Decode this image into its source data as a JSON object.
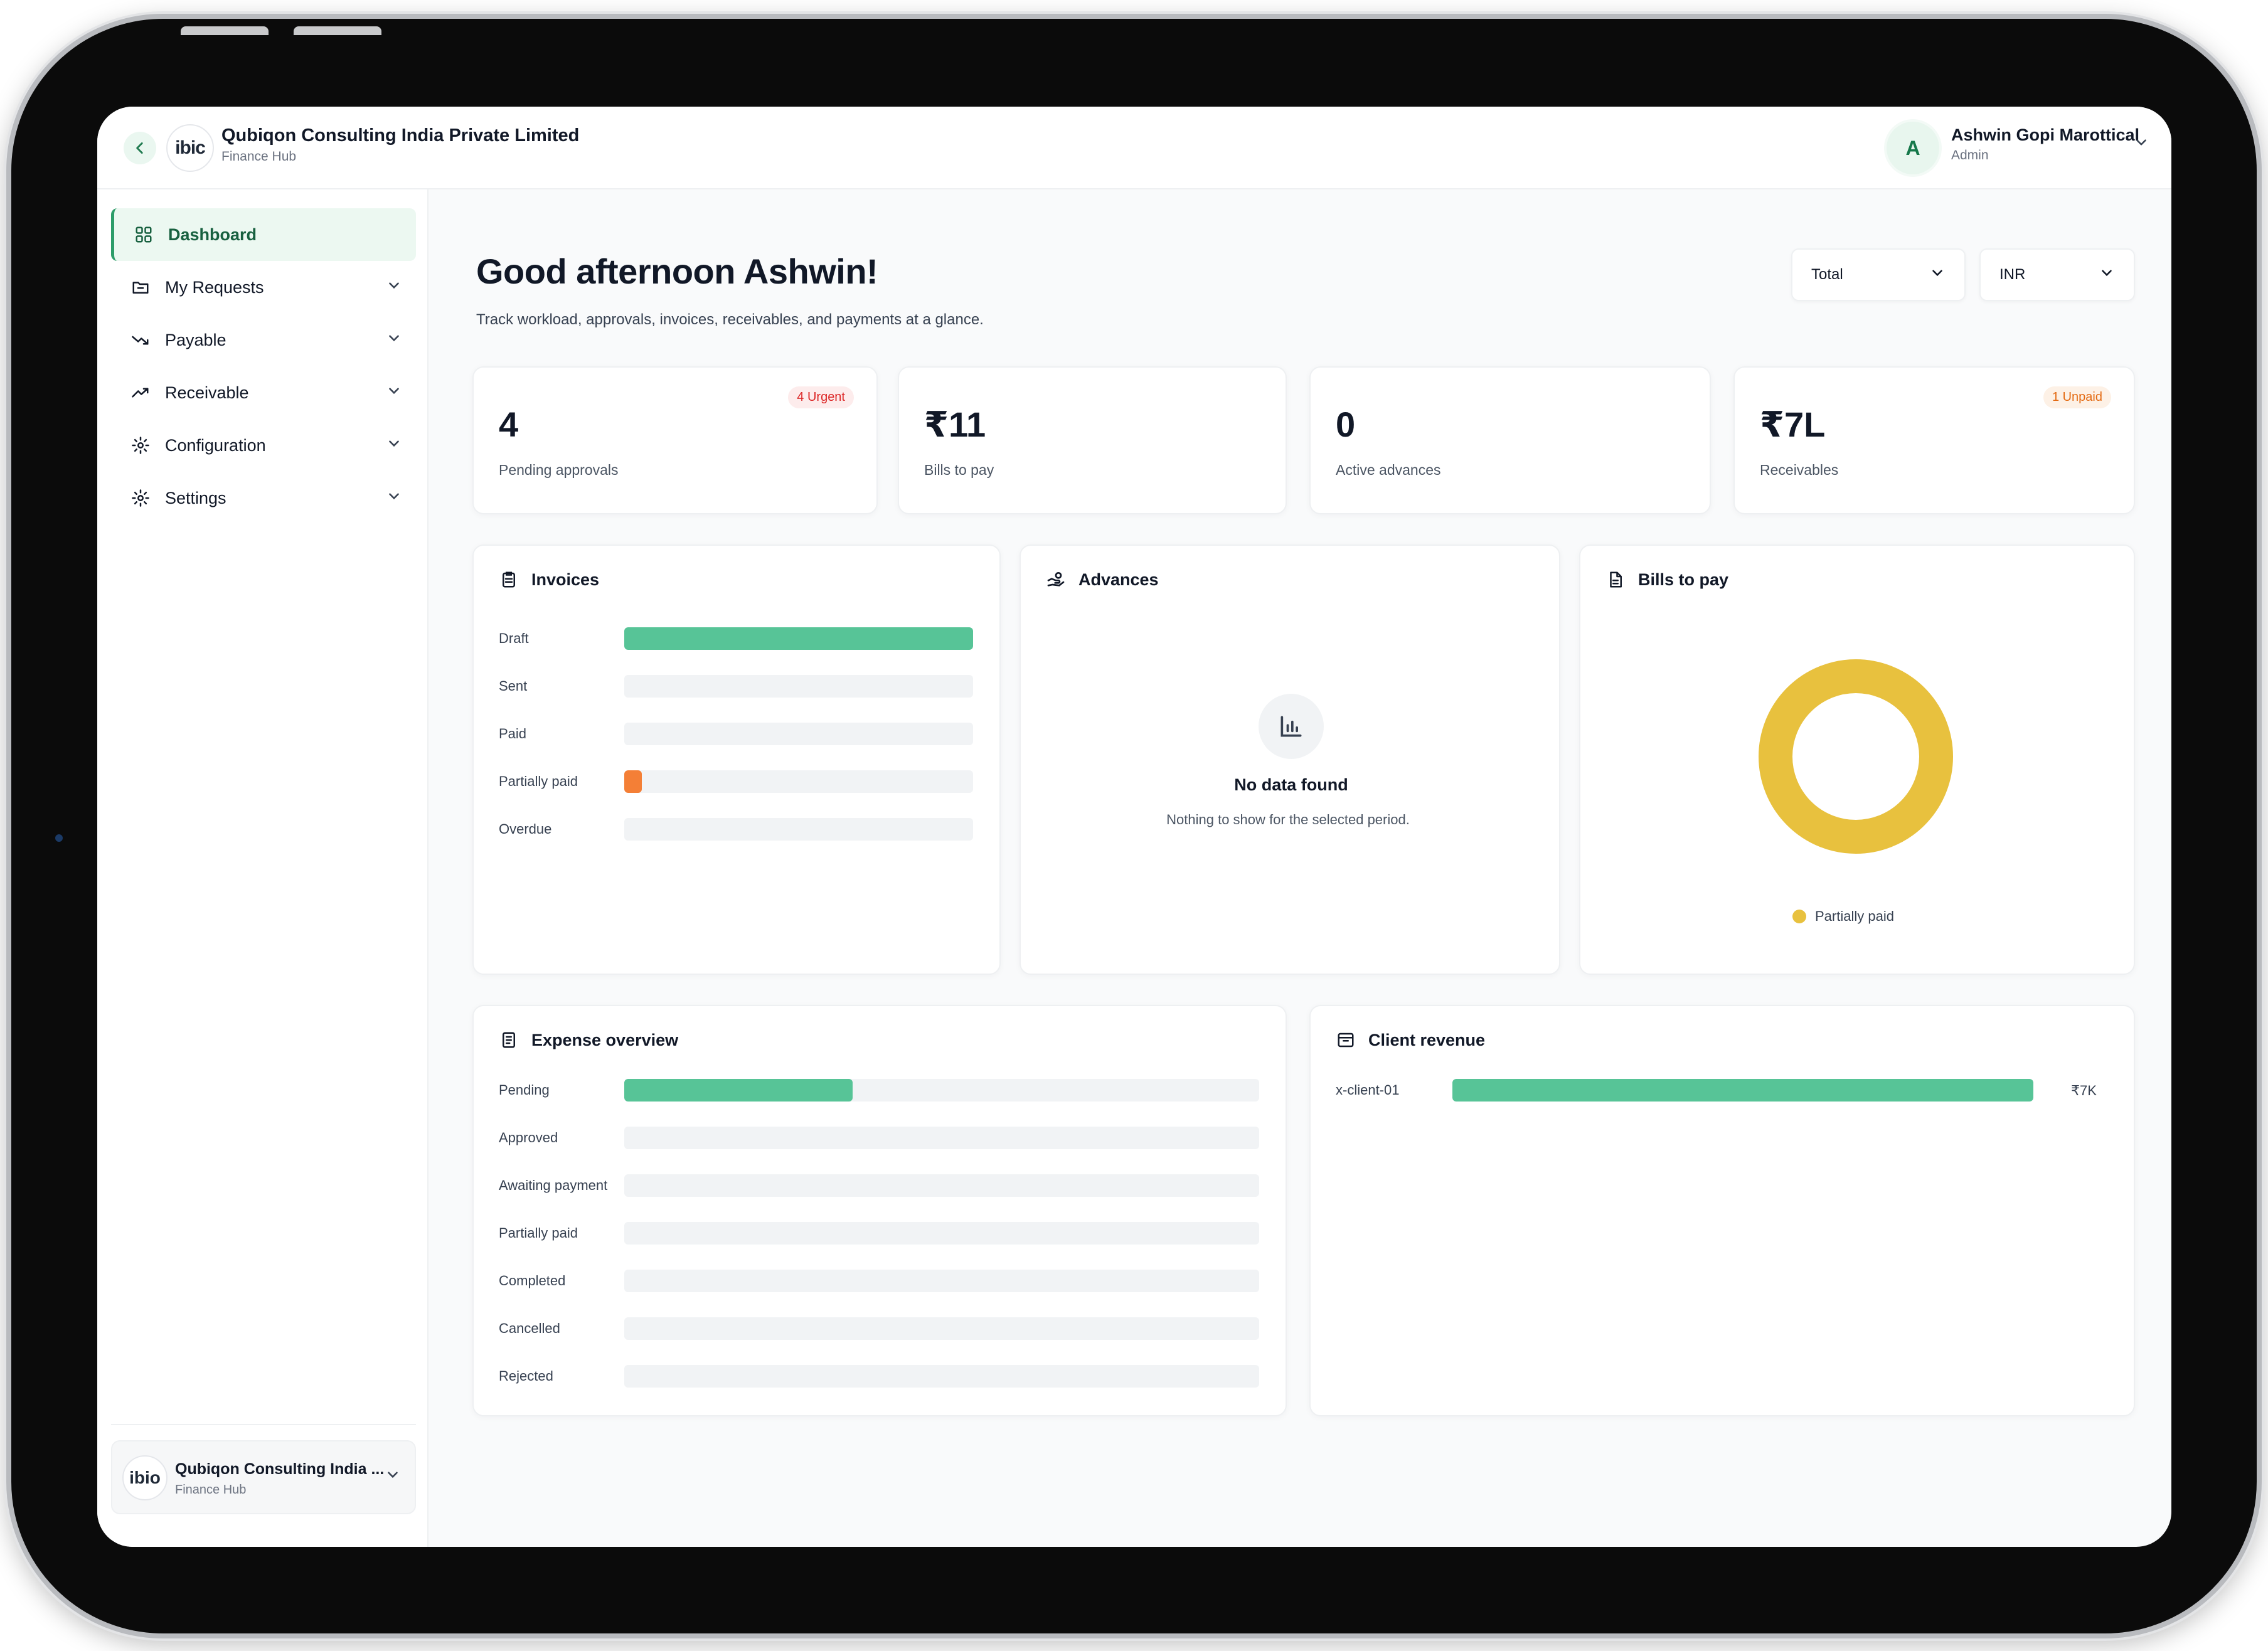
{
  "header": {
    "back_icon": "chevron-left-icon",
    "logo_text": "ibic",
    "org_name": "Qubiqon Consulting India Private Limited",
    "org_sub": "Finance Hub",
    "avatar_letter": "A",
    "user_name": "Ashwin Gopi Marottical",
    "user_role": "Admin"
  },
  "sidebar": {
    "items": [
      {
        "label": "Dashboard",
        "icon": "grid-icon",
        "active": true
      },
      {
        "label": "My Requests",
        "icon": "folder-icon"
      },
      {
        "label": "Payable",
        "icon": "trend-down-icon"
      },
      {
        "label": "Receivable",
        "icon": "trend-up-icon"
      },
      {
        "label": "Configuration",
        "icon": "gear-icon"
      },
      {
        "label": "Settings",
        "icon": "gear-icon"
      }
    ],
    "footer": {
      "logo_text": "ibio",
      "name": "Qubiqon Consulting India ...",
      "sub": "Finance Hub"
    }
  },
  "main": {
    "greeting": "Good afternoon Ashwin!",
    "subtitle": "Track workload, approvals, invoices, receivables, and payments at a glance.",
    "filters": {
      "period": "Total",
      "currency": "INR"
    },
    "stats": [
      {
        "value": "4",
        "label": "Pending approvals",
        "badge": "4 Urgent"
      },
      {
        "value": "₹11",
        "label": "Bills to pay",
        "badge": ""
      },
      {
        "value": "0",
        "label": "Active advances",
        "badge": ""
      },
      {
        "value": "₹7L",
        "label": "Receivables",
        "badge": "1 Unpaid"
      }
    ],
    "invoices": {
      "title": "Invoices",
      "rows": [
        {
          "label": "Draft",
          "fraction": 1.0,
          "color": "#57c497"
        },
        {
          "label": "Sent",
          "fraction": 0
        },
        {
          "label": "Paid",
          "fraction": 0
        },
        {
          "label": "Partially paid",
          "fraction": 0.05,
          "color": "#f47f36"
        },
        {
          "label": "Overdue",
          "fraction": 0
        }
      ]
    },
    "advances": {
      "title": "Advances",
      "empty_title": "No data found",
      "empty_sub": "Nothing to show for the selected period."
    },
    "bills": {
      "title": "Bills to pay",
      "legend": "Partially paid",
      "donut_color": "#e8c13e",
      "share": 1.0
    },
    "expense": {
      "title": "Expense overview",
      "rows": [
        {
          "label": "Pending",
          "fraction": 0.36,
          "color": "#57c497"
        },
        {
          "label": "Approved",
          "fraction": 0
        },
        {
          "label": "Awaiting payment",
          "fraction": 0
        },
        {
          "label": "Partially paid",
          "fraction": 0
        },
        {
          "label": "Completed",
          "fraction": 0
        },
        {
          "label": "Cancelled",
          "fraction": 0
        },
        {
          "label": "Rejected",
          "fraction": 0
        }
      ]
    },
    "client_revenue": {
      "title": "Client revenue",
      "rows": [
        {
          "label": "x-client-01",
          "fraction": 1.0,
          "value": "₹7K",
          "color": "#57c497"
        }
      ]
    }
  },
  "colors": {
    "accent": "#2e9d6a",
    "bar_green": "#57c497",
    "bar_orange": "#f47f36",
    "donut_yellow": "#e8c13e",
    "urgent_red": "#dc2626",
    "unpaid_orange": "#e46a12"
  }
}
